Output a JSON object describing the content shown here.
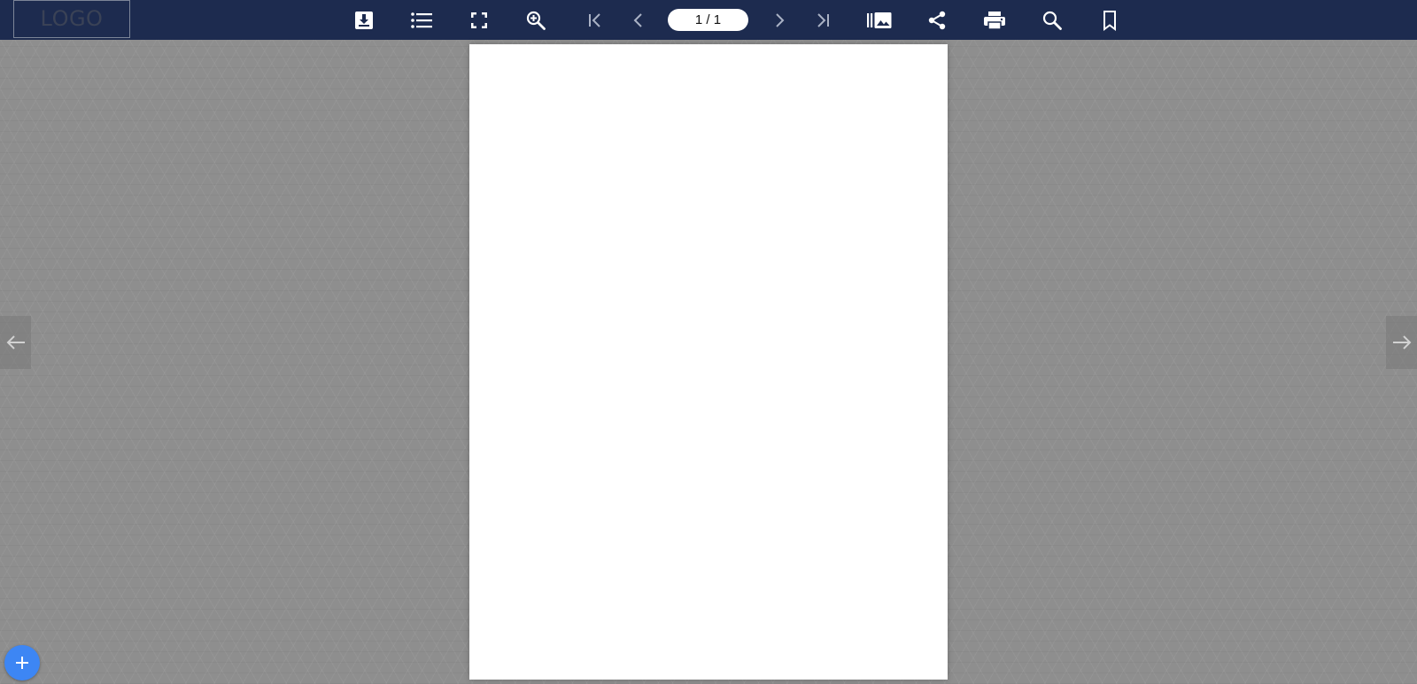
{
  "header": {
    "logo_text": "LOGO",
    "page_indicator": "1 / 1"
  },
  "toolbar": {
    "buttons": [
      {
        "name": "download",
        "icon": "download-icon"
      },
      {
        "name": "table-of-contents",
        "icon": "list-icon"
      },
      {
        "name": "fullscreen",
        "icon": "fullscreen-icon"
      },
      {
        "name": "zoom-in",
        "icon": "zoom-in-icon"
      },
      {
        "name": "first-page",
        "icon": "first-page-icon"
      },
      {
        "name": "previous-page",
        "icon": "chevron-left-icon"
      },
      {
        "name": "next-page",
        "icon": "chevron-right-icon"
      },
      {
        "name": "last-page",
        "icon": "last-page-icon"
      },
      {
        "name": "thumbnails",
        "icon": "thumbnails-icon"
      },
      {
        "name": "share",
        "icon": "share-icon"
      },
      {
        "name": "print",
        "icon": "print-icon"
      },
      {
        "name": "search",
        "icon": "search-icon"
      },
      {
        "name": "bookmark",
        "icon": "bookmark-icon"
      }
    ]
  },
  "colors": {
    "toolbar_bg": "#1d2b4f",
    "page_bg": "#ffffff",
    "viewer_bg": "#8e8e8e",
    "fab_bg": "#3d86f4"
  }
}
